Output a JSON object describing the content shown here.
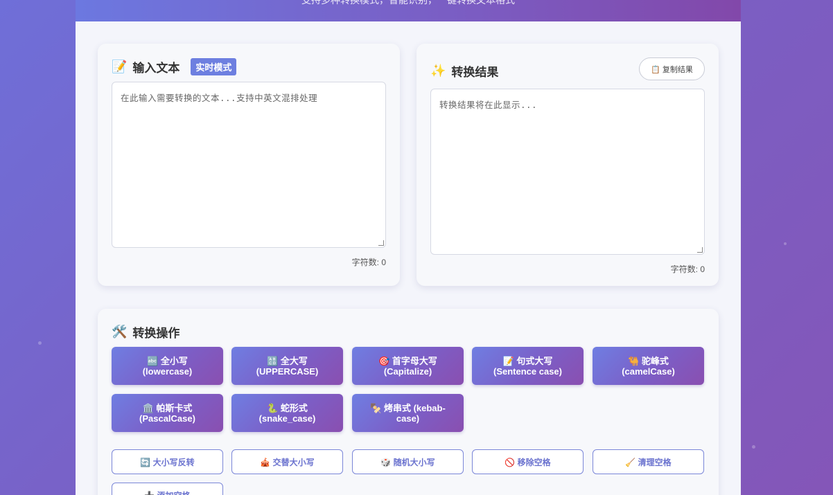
{
  "header": {
    "subtitle": "支持多种转换模式，智能识别，一键转换文本格式"
  },
  "input_panel": {
    "icon": "memo-icon",
    "title": "输入文本",
    "badge": "实时模式",
    "placeholder": "在此输入需要转换的文本...支持中英文混排处理",
    "char_count": "字符数: 0"
  },
  "result_panel": {
    "icon": "sparkles-icon",
    "title": "转换结果",
    "copy_label": "📋 复制结果",
    "placeholder": "转换结果将在此显示...",
    "char_count": "字符数: 0"
  },
  "ops_panel": {
    "icon": "tools-icon",
    "title": "转换操作",
    "primary": [
      {
        "name": "lowercase",
        "line1": "🔤 全小写",
        "line2": "(lowercase)"
      },
      {
        "name": "uppercase",
        "line1": "🔠 全大写",
        "line2": "(UPPERCASE)"
      },
      {
        "name": "capitalize",
        "line1": "🎯 首字母大写",
        "line2": "(Capitalize)"
      },
      {
        "name": "sentence-case",
        "line1": "📝 句式大写",
        "line2": "(Sentence case)"
      },
      {
        "name": "camel-case",
        "line1": "🐫 驼峰式",
        "line2": "(camelCase)"
      },
      {
        "name": "pascal-case",
        "line1": "🏛️ 帕斯卡式",
        "line2": "(PascalCase)"
      },
      {
        "name": "snake-case",
        "line1": "🐍 蛇形式",
        "line2": "(snake_case)"
      },
      {
        "name": "kebab-case",
        "line1": "🍢 烤串式 (kebab-",
        "line2": "case)"
      }
    ],
    "secondary": [
      {
        "name": "invert-case",
        "label": "🔄 大小写反转"
      },
      {
        "name": "alternate-case",
        "label": "🎪 交替大小写"
      },
      {
        "name": "random-case",
        "label": "🎲 随机大小写"
      },
      {
        "name": "remove-spaces",
        "label": "🚫 移除空格"
      },
      {
        "name": "clean-spaces",
        "label": "🧹 清理空格"
      },
      {
        "name": "add-spaces",
        "label": "➕ 添加空格"
      }
    ]
  }
}
